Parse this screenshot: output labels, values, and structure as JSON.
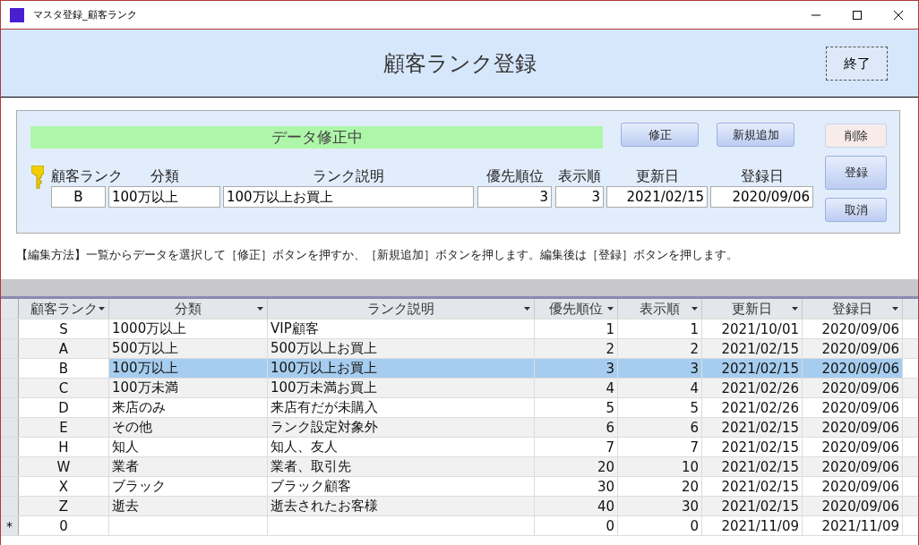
{
  "window": {
    "title": "マスタ登録_顧客ランク"
  },
  "header": {
    "title": "顧客ランク登録",
    "close_button": "終了"
  },
  "status": "データ修正中",
  "top_buttons": [
    {
      "label": "修正"
    },
    {
      "label": "新規追加"
    }
  ],
  "side_buttons": [
    {
      "label": "削除",
      "kind": "delete"
    },
    {
      "label": "登録",
      "kind": "normal"
    },
    {
      "label": "取消",
      "kind": "normal"
    }
  ],
  "form_fields": [
    {
      "label": "顧客ランク",
      "value": "B",
      "key": true
    },
    {
      "label": "分類",
      "value": "100万以上"
    },
    {
      "label": "ランク説明",
      "value": "100万以上お買上"
    },
    {
      "label": "優先順位",
      "value": "3"
    },
    {
      "label": "表示順",
      "value": "3"
    },
    {
      "label": "更新日",
      "value": "2021/02/15"
    },
    {
      "label": "登録日",
      "value": "2020/09/06"
    }
  ],
  "instructions": "【編集方法】一覧からデータを選択して［修正］ボタンを押すか、［新規追加］ボタンを押します。編集後は［登録］ボタンを押します。",
  "table": {
    "columns": [
      "顧客ランク",
      "分類",
      "ランク説明",
      "優先順位",
      "表示順",
      "更新日",
      "登録日"
    ],
    "rows": [
      {
        "cells": [
          "S",
          "1000万以上",
          "VIP顧客",
          "1",
          "1",
          "2021/10/01",
          "2020/09/06"
        ],
        "selected": false
      },
      {
        "cells": [
          "A",
          "500万以上",
          "500万以上お買上",
          "2",
          "2",
          "2021/02/15",
          "2020/09/06"
        ],
        "selected": false
      },
      {
        "cells": [
          "B",
          "100万以上",
          "100万以上お買上",
          "3",
          "3",
          "2021/02/15",
          "2020/09/06"
        ],
        "selected": true
      },
      {
        "cells": [
          "C",
          "100万未満",
          "100万未満お買上",
          "4",
          "4",
          "2021/02/26",
          "2020/09/06"
        ],
        "selected": false
      },
      {
        "cells": [
          "D",
          "来店のみ",
          "来店有だが未購入",
          "5",
          "5",
          "2021/02/26",
          "2020/09/06"
        ],
        "selected": false
      },
      {
        "cells": [
          "E",
          "その他",
          "ランク設定対象外",
          "6",
          "6",
          "2021/02/15",
          "2020/09/06"
        ],
        "selected": false
      },
      {
        "cells": [
          "H",
          "知人",
          "知人、友人",
          "7",
          "7",
          "2021/02/15",
          "2020/09/06"
        ],
        "selected": false
      },
      {
        "cells": [
          "W",
          "業者",
          "業者、取引先",
          "20",
          "10",
          "2021/02/15",
          "2020/09/06"
        ],
        "selected": false
      },
      {
        "cells": [
          "X",
          "ブラック",
          "ブラック顧客",
          "30",
          "20",
          "2021/02/15",
          "2020/09/06"
        ],
        "selected": false
      },
      {
        "cells": [
          "Z",
          "逝去",
          "逝去されたお客様",
          "40",
          "30",
          "2021/02/15",
          "2020/09/06"
        ],
        "selected": false
      },
      {
        "cells": [
          "0",
          "",
          "",
          "0",
          "0",
          "2021/11/09",
          "2021/11/09"
        ],
        "selected": false,
        "marker": "*"
      }
    ]
  }
}
